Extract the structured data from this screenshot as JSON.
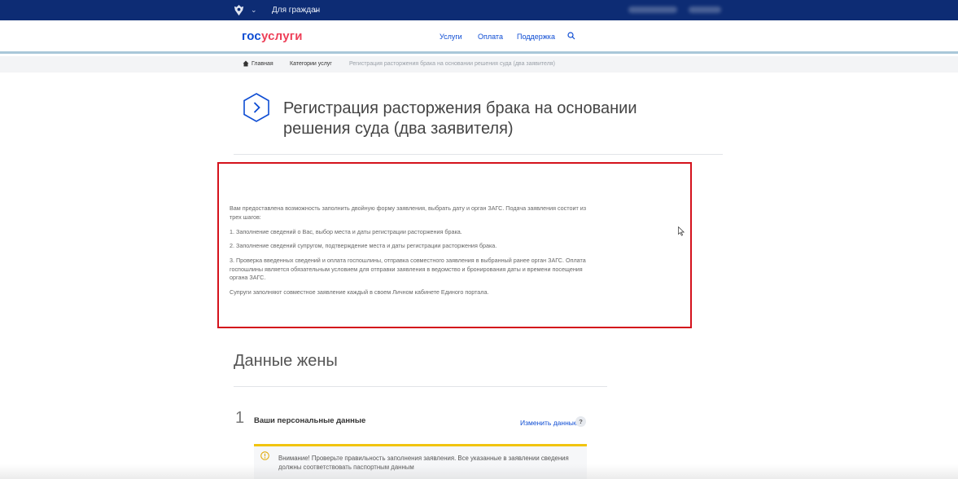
{
  "topbar": {
    "for_citizens": "Для граждан"
  },
  "header": {
    "logo_part1": "гос",
    "logo_part2": "услуги",
    "nav": [
      "Услуги",
      "Оплата",
      "Поддержка"
    ]
  },
  "breadcrumb": {
    "home": "Главная",
    "categories": "Категории услуг",
    "current": "Регистрация расторжения брака на основании решения суда (два заявителя)"
  },
  "page": {
    "title": "Регистрация расторжения брака на основании решения суда (два заявителя)"
  },
  "info": {
    "intro": "Вам предоставлена возможность заполнить двойную форму заявления, выбрать дату и орган ЗАГС. Подача заявления состоит из трех шагов:",
    "steps": [
      "1. Заполнение сведений о Вас, выбор места и даты регистрации расторжения брака.",
      "2. Заполнение сведений супругом, подтверждение места и даты регистрации расторжения брака.",
      "3. Проверка введенных сведений и оплата госпошлины, отправка совместного заявления в выбранный ранее орган ЗАГС. Оплата госпошлины является обязательным условием для отправки заявления в ведомство и бронирования даты и времени посещения органа ЗАГС."
    ],
    "note": "Супруги заполняют совместное заявление каждый в своем Личном кабинете Единого портала."
  },
  "wife_section": {
    "title": "Данные жены"
  },
  "step1": {
    "number": "1",
    "title": "Ваши персональные данные",
    "change_link": "Изменить данные",
    "help": "?"
  },
  "warning": {
    "text": "Внимание! Проверьте правильность заполнения заявления. Все указанные в заявлении сведения должны соответствовать паспортным данным"
  },
  "colors": {
    "topbar": "#0d2c74",
    "brand_blue": "#0d4cd3",
    "brand_red": "#ee3f58",
    "highlight_border": "#d4121c",
    "warning_accent": "#f1c40f"
  }
}
